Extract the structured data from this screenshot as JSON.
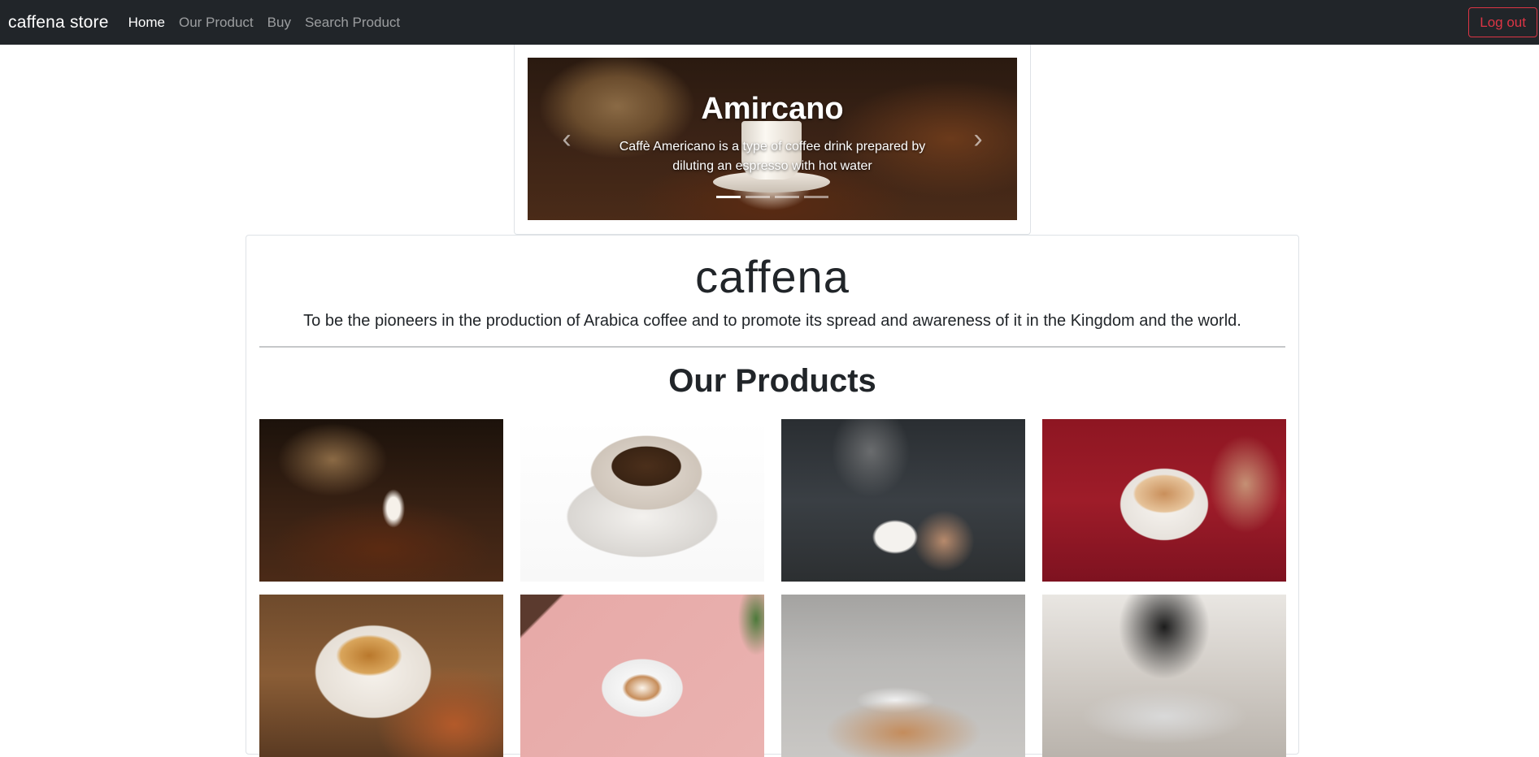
{
  "navbar": {
    "brand": "caffena store",
    "links": [
      "Home",
      "Our Product",
      "Buy",
      "Search Product"
    ],
    "logout": "Log out"
  },
  "carousel": {
    "title": "Amircano",
    "caption": "Caffè Americano is a type of coffee drink prepared by diluting an espresso with hot water",
    "prev_icon": "chevron-left-icon",
    "next_icon": "chevron-right-icon",
    "indicator_count": 4,
    "active_index": 0
  },
  "hero": {
    "title": "caffena",
    "lead": "To be the pioneers in the production of Arabica coffee and to promote its spread and awareness of it in the Kingdom and the world."
  },
  "products": {
    "heading": "Our Products",
    "items": [
      "coffee beans sack with cup",
      "coffee cup with spoon",
      "pouring coffee",
      "latte art cup",
      "espresso cup",
      "heart latte",
      "coffee table with magazine",
      "barista pour-over"
    ]
  },
  "colors": {
    "navbar_bg": "#212529",
    "logout_border": "#dc3545"
  }
}
